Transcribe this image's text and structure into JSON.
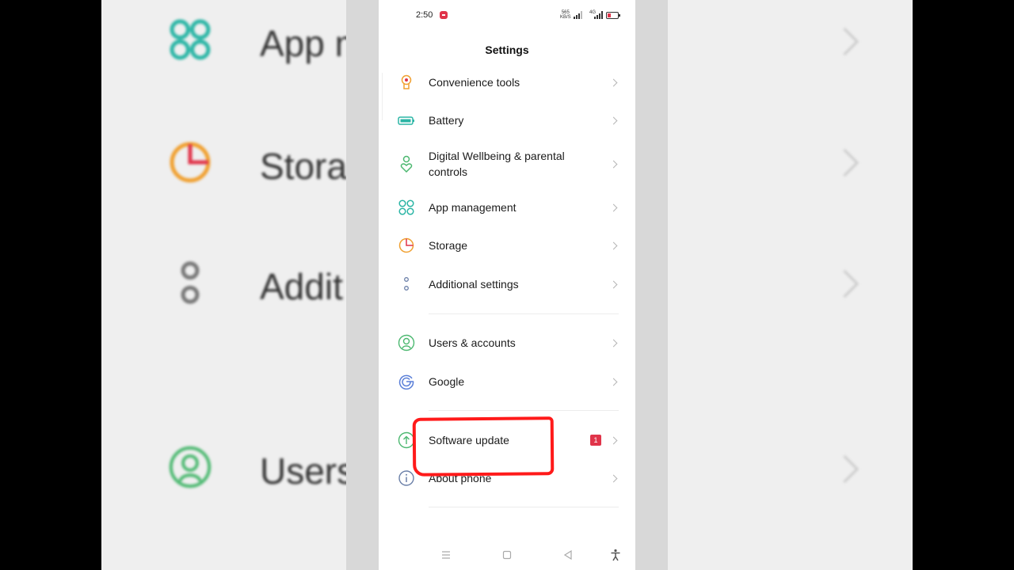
{
  "status_bar": {
    "time": "2:50",
    "speed_value": "565",
    "speed_unit": "KB/S",
    "sim2_label": "4G"
  },
  "page": {
    "title": "Settings"
  },
  "settings": {
    "items": [
      {
        "label": "Convenience tools",
        "icon": "hand-pointer-icon",
        "color": "#f0a030"
      },
      {
        "label": "Battery",
        "icon": "battery-icon",
        "color": "#2bb5a5"
      },
      {
        "label": "Digital Wellbeing & parental controls",
        "icon": "wellbeing-icon",
        "color": "#4cb870"
      },
      {
        "label": "App management",
        "icon": "app-grid-icon",
        "color": "#2bb5a5"
      },
      {
        "label": "Storage",
        "icon": "storage-pie-icon",
        "color": "#f0a030"
      },
      {
        "label": "Additional settings",
        "icon": "dots-icon",
        "color": "#6a7fa8"
      },
      {
        "label": "Users & accounts",
        "icon": "user-icon",
        "color": "#4cb870"
      },
      {
        "label": "Google",
        "icon": "google-icon",
        "color": "#5a7fd8"
      },
      {
        "label": "Software update",
        "icon": "update-arrow-icon",
        "color": "#4cb870",
        "badge": "1"
      },
      {
        "label": "About phone",
        "icon": "info-icon",
        "color": "#6a7fa8"
      }
    ]
  },
  "nav_bar": {
    "items": [
      "menu-icon",
      "home-icon",
      "back-icon",
      "accessibility-icon"
    ]
  },
  "background": {
    "rows": [
      "App m",
      "Stora",
      "Addit",
      "Users"
    ]
  }
}
